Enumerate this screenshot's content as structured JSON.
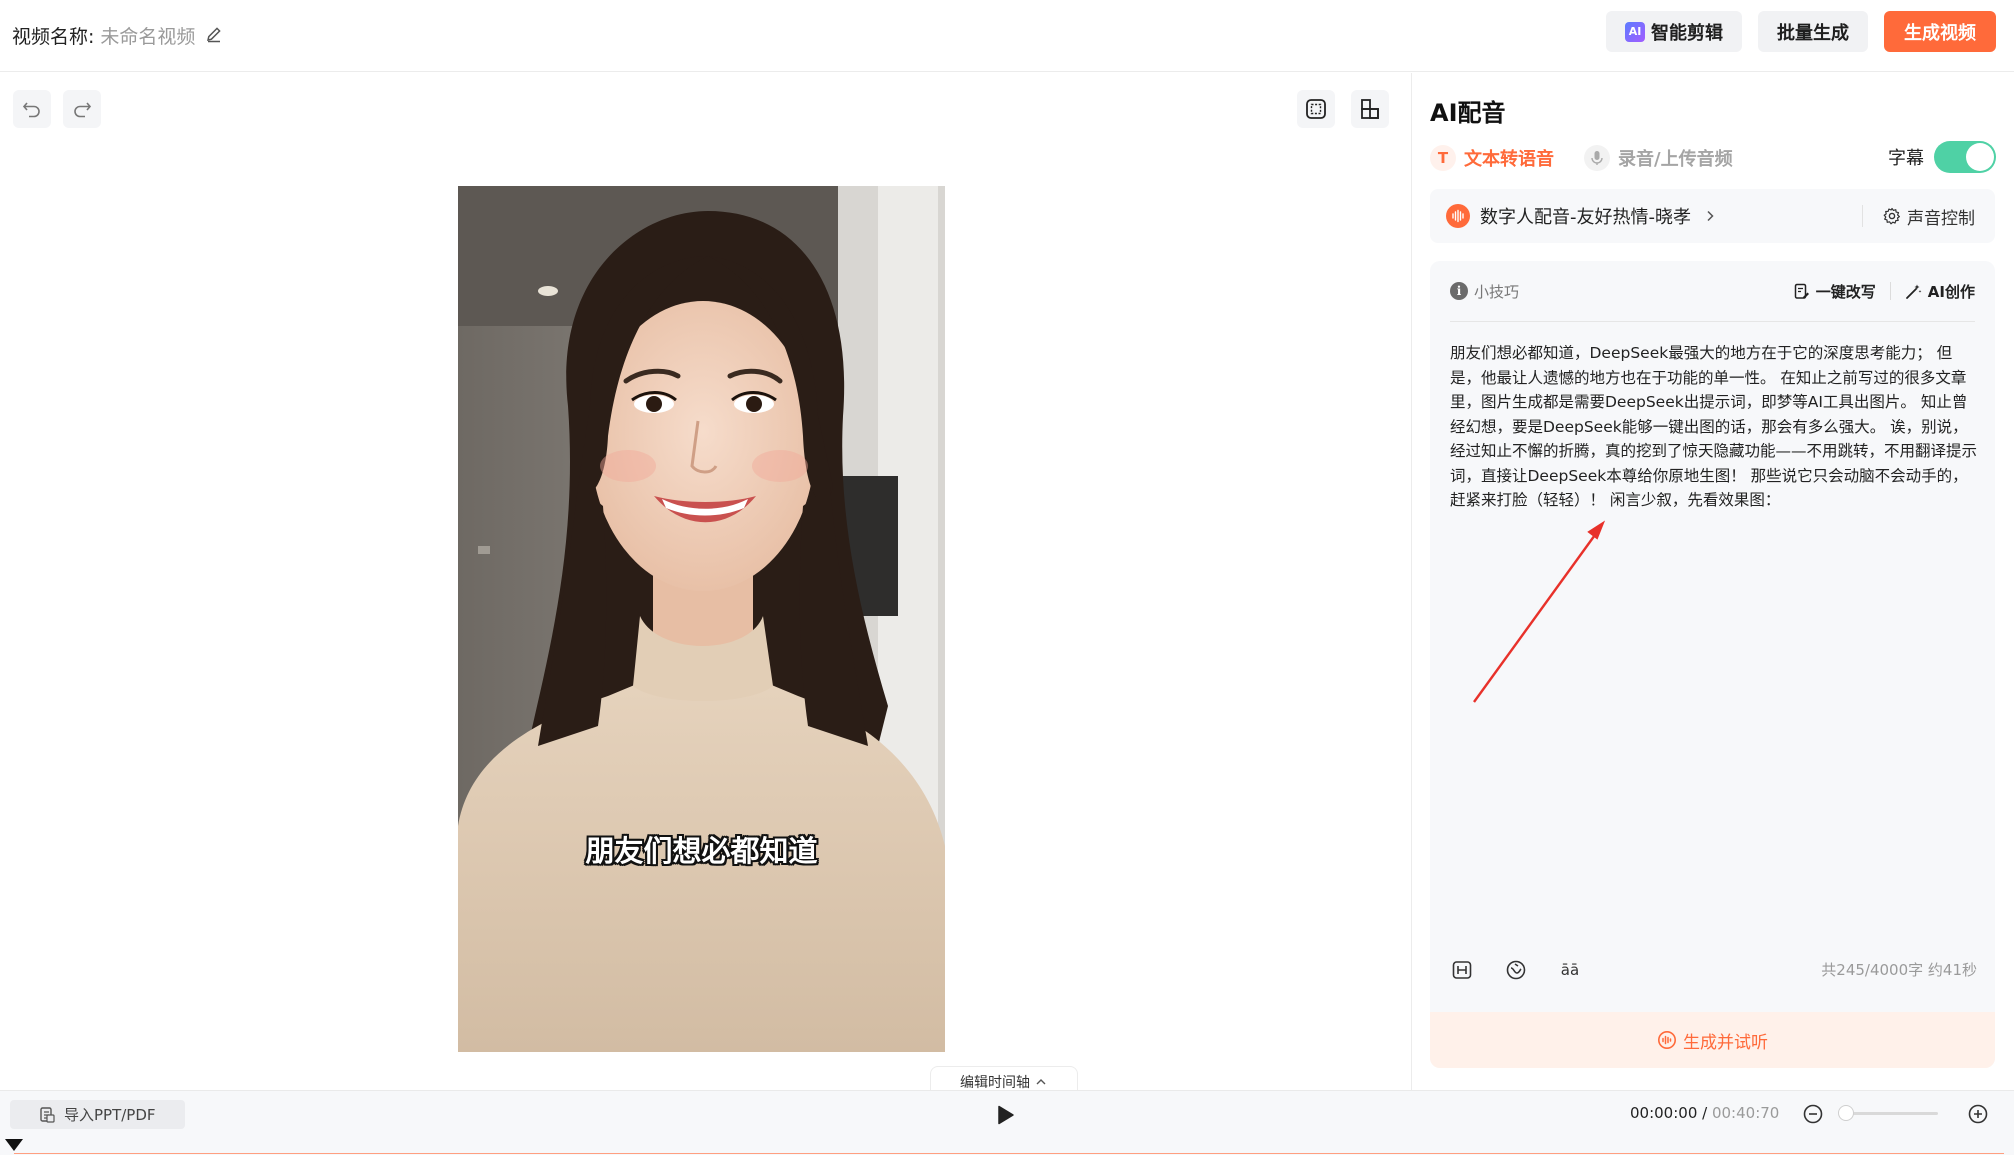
{
  "header": {
    "title_label": "视频名称:",
    "title_value": "未命名视频",
    "smart_edit_label": "智能剪辑",
    "smart_edit_badge": "AI",
    "batch_label": "批量生成",
    "generate_label": "生成视频"
  },
  "preview": {
    "subtitle": "朋友们想必都知道",
    "timeline_tab": "编辑时间轴"
  },
  "bottom": {
    "import_label": "导入PPT/PDF",
    "time_current": "00:00:00",
    "time_sep": " / ",
    "time_total": "00:40:70",
    "zoom_level": 0
  },
  "panel": {
    "title": "AI配音",
    "tabs": [
      {
        "label": "文本转语音",
        "icon": "T",
        "active": true
      },
      {
        "label": "录音/上传音频",
        "icon": "mic-icon",
        "active": false
      }
    ],
    "subtitle_toggle_label": "字幕",
    "subtitle_toggle_on": true,
    "voice_name": "数字人配音-友好热情-晓孝",
    "voice_control_label": "声音控制",
    "tips_label": "小技巧",
    "rewrite_label": "一键改写",
    "ai_create_label": "AI创作",
    "script_text": "朋友们想必都知道，DeepSeek最强大的地方在于它的深度思考能力； 但是，他最让人遗憾的地方也在于功能的单一性。 在知止之前写过的很多文章里，图片生成都是需要DeepSeek出提示词，即梦等AI工具出图片。 知止曾经幻想，要是DeepSeek能够一键出图的话，那会有多么强大。 诶，别说，经过知止不懈的折腾，真的挖到了惊天隐藏功能——不用跳转，不用翻译提示词，直接让DeepSeek本尊给你原地生图！ 那些说它只会动脑不会动手的，赶紧来打脸（轻轻）！ 闲言少叙，先看效果图：",
    "pinyin_tool_label": "āā",
    "char_count": "共245/4000字 约41秒",
    "generate_listen_label": "生成并试听"
  },
  "colors": {
    "accent": "#ff6a3a",
    "toggle_on": "#4fd1a5",
    "annotation_arrow": "#e8312a"
  }
}
